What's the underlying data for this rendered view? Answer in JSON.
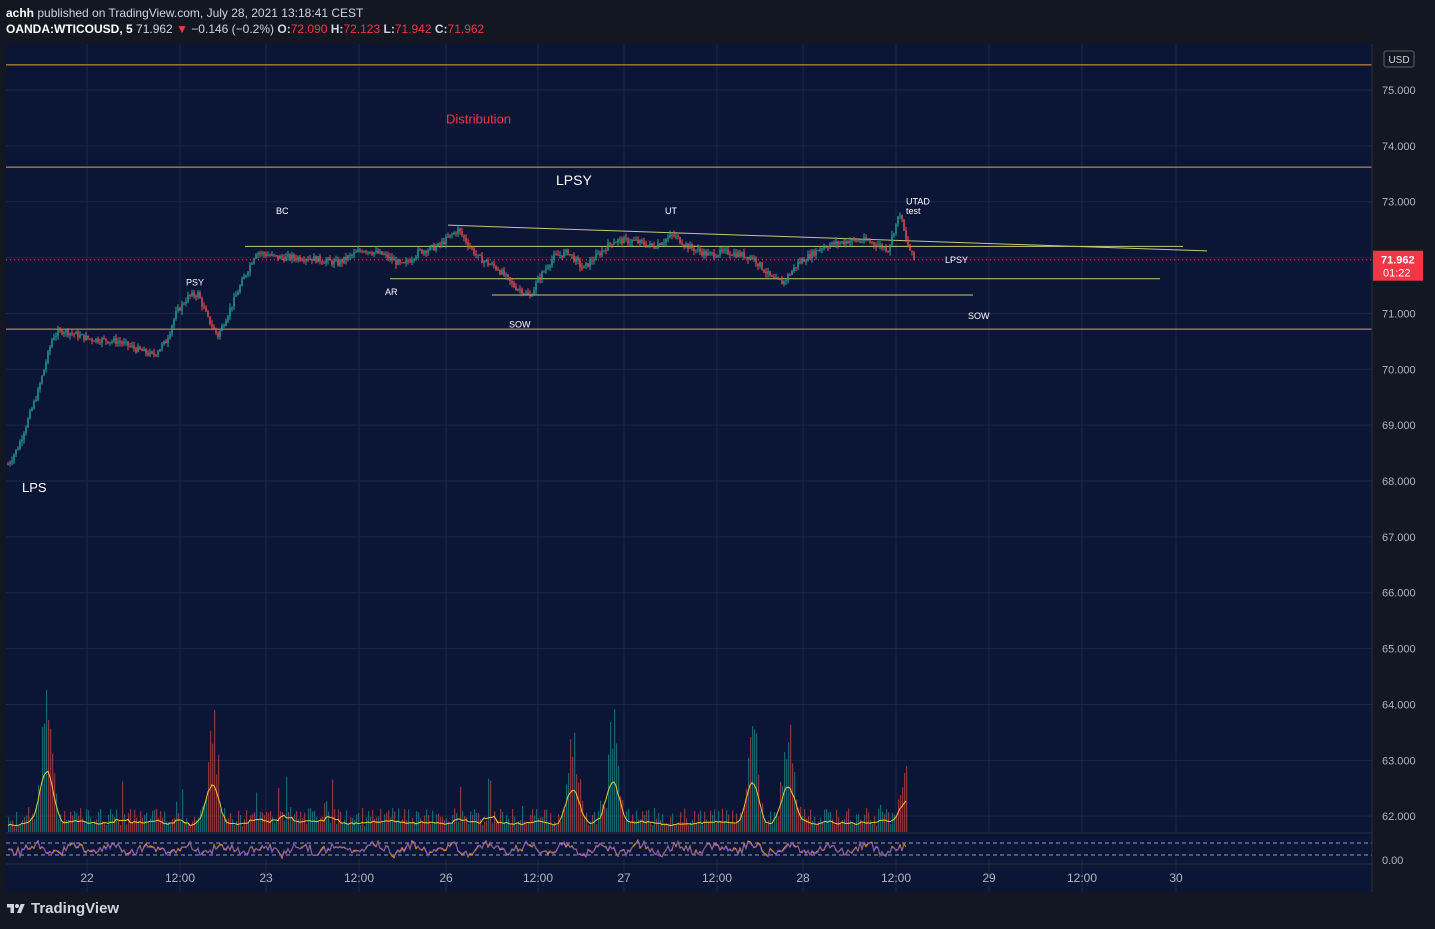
{
  "header": {
    "published": "achh published on TradingView.com, July 28, 2021 13:18:41 CEST",
    "publisher": "achh",
    "published_rest": " published on TradingView.com, July 28, 2021 13:18:41 CEST",
    "symbol": "OANDA:WTICOUSD, 5",
    "last": "71.962",
    "change": "−0.146 (−0.2%)",
    "o_label": "O:",
    "o": "72.090",
    "h_label": "H:",
    "h": "72.123",
    "l_label": "L:",
    "l": "71.942",
    "c_label": "C:",
    "c": "71.962"
  },
  "footer": {
    "brand": "TradingView"
  },
  "colors": {
    "background": "#0b1535",
    "up": "#26a69a",
    "down": "#ef5350",
    "level": "#e8a33a",
    "trend": "#c8c873",
    "label_red": "#f23645",
    "volume_ma": "#f0c830",
    "osc_a": "#7e57c2",
    "osc_b": "#ff9800"
  },
  "chart_data": {
    "type": "candlestick",
    "currency": "USD",
    "y_ticks": [
      "75.000",
      "74.000",
      "73.000",
      "72.000",
      "71.000",
      "70.000",
      "69.000",
      "68.000",
      "67.000",
      "66.000",
      "65.000",
      "64.000",
      "63.000",
      "62.000"
    ],
    "ylim": [
      61.8,
      75.5
    ],
    "osc_tick": "0.00",
    "x_ticks": [
      "22",
      "12:00",
      "23",
      "12:00",
      "26",
      "12:00",
      "27",
      "12:00",
      "28",
      "12:00",
      "29",
      "12:00",
      "30"
    ],
    "last_price": "71.962",
    "countdown": "01:22",
    "price_path": [
      [
        0,
        68.3
      ],
      [
        10,
        68.6
      ],
      [
        30,
        69.6
      ],
      [
        45,
        70.6
      ],
      [
        55,
        70.7
      ],
      [
        80,
        70.55
      ],
      [
        110,
        70.5
      ],
      [
        130,
        70.35
      ],
      [
        145,
        70.25
      ],
      [
        158,
        70.5
      ],
      [
        168,
        71.0
      ],
      [
        180,
        71.3
      ],
      [
        190,
        71.35
      ],
      [
        200,
        70.9
      ],
      [
        210,
        70.6
      ],
      [
        220,
        71.0
      ],
      [
        235,
        71.6
      ],
      [
        248,
        72.1
      ],
      [
        270,
        72.0
      ],
      [
        300,
        72.0
      ],
      [
        330,
        71.9
      ],
      [
        355,
        72.15
      ],
      [
        375,
        72.05
      ],
      [
        395,
        71.85
      ],
      [
        410,
        72.1
      ],
      [
        430,
        72.2
      ],
      [
        450,
        72.5
      ],
      [
        470,
        72.0
      ],
      [
        490,
        71.8
      ],
      [
        505,
        71.5
      ],
      [
        515,
        71.4
      ],
      [
        522,
        71.3
      ],
      [
        530,
        71.6
      ],
      [
        545,
        72.0
      ],
      [
        560,
        72.1
      ],
      [
        575,
        71.8
      ],
      [
        590,
        72.05
      ],
      [
        605,
        72.3
      ],
      [
        625,
        72.3
      ],
      [
        645,
        72.2
      ],
      [
        665,
        72.4
      ],
      [
        680,
        72.2
      ],
      [
        700,
        72.05
      ],
      [
        720,
        72.1
      ],
      [
        745,
        72.0
      ],
      [
        765,
        71.6
      ],
      [
        775,
        71.55
      ],
      [
        790,
        71.9
      ],
      [
        815,
        72.2
      ],
      [
        840,
        72.3
      ],
      [
        860,
        72.3
      ],
      [
        880,
        72.15
      ],
      [
        888,
        72.6
      ],
      [
        892,
        72.8
      ],
      [
        898,
        72.3
      ],
      [
        906,
        71.96
      ]
    ],
    "levels": [
      {
        "name": "top-level",
        "y": 75.45
      },
      {
        "name": "upper-level",
        "y": 73.62
      },
      {
        "name": "support-level",
        "y": 70.72
      }
    ],
    "trendlines": [
      {
        "name": "upper-trendline",
        "x1": 448,
        "y1": 72.58,
        "x2": 1207,
        "y2": 72.12
      },
      {
        "name": "mid-trendline",
        "x1": 245,
        "y1": 72.2,
        "x2": 1183,
        "y2": 72.2
      },
      {
        "name": "ar-line",
        "x1": 390,
        "y1": 71.62,
        "x2": 1160,
        "y2": 71.62
      },
      {
        "name": "sow-line",
        "x1": 492,
        "y1": 71.33,
        "x2": 973,
        "y2": 71.33
      }
    ],
    "annotations": [
      {
        "name": "label-distribution",
        "text": "Distribution",
        "x": 446,
        "y": 74.4,
        "color": "#f23645",
        "size": 13
      },
      {
        "name": "label-lpsy-main",
        "text": "LPSY",
        "x": 556,
        "y": 73.3,
        "color": "#ffffff",
        "size": 14
      },
      {
        "name": "label-bc",
        "text": "BC",
        "x": 276,
        "y": 72.78,
        "color": "#ffffff",
        "size": 9
      },
      {
        "name": "label-psy",
        "text": "PSY",
        "x": 186,
        "y": 71.5,
        "color": "#ffffff",
        "size": 9
      },
      {
        "name": "label-ar",
        "text": "AR",
        "x": 385,
        "y": 71.33,
        "color": "#ffffff",
        "size": 9
      },
      {
        "name": "label-sow-left",
        "text": "SOW",
        "x": 509,
        "y": 70.75,
        "color": "#ffffff",
        "size": 9
      },
      {
        "name": "label-ut",
        "text": "UT",
        "x": 665,
        "y": 72.78,
        "color": "#ffffff",
        "size": 9
      },
      {
        "name": "label-utad",
        "text": "UTAD",
        "x": 906,
        "y": 72.95,
        "color": "#ffffff",
        "size": 9
      },
      {
        "name": "label-test",
        "text": "test",
        "x": 906,
        "y": 72.78,
        "color": "#ffffff",
        "size": 9
      },
      {
        "name": "label-lpsy-right",
        "text": "LPSY",
        "x": 945,
        "y": 71.9,
        "color": "#ffffff",
        "size": 9
      },
      {
        "name": "label-sow-right",
        "text": "SOW",
        "x": 968,
        "y": 70.9,
        "color": "#ffffff",
        "size": 9
      },
      {
        "name": "label-lps",
        "text": "LPS",
        "x": 22,
        "y": 67.8,
        "color": "#ffffff",
        "size": 13
      }
    ],
    "volume_spikes": [
      [
        38,
        1.0
      ],
      [
        205,
        0.6
      ],
      [
        780,
        0.7
      ],
      [
        605,
        0.65
      ],
      [
        565,
        0.55
      ],
      [
        745,
        0.5
      ],
      [
        898,
        0.35
      ]
    ]
  }
}
